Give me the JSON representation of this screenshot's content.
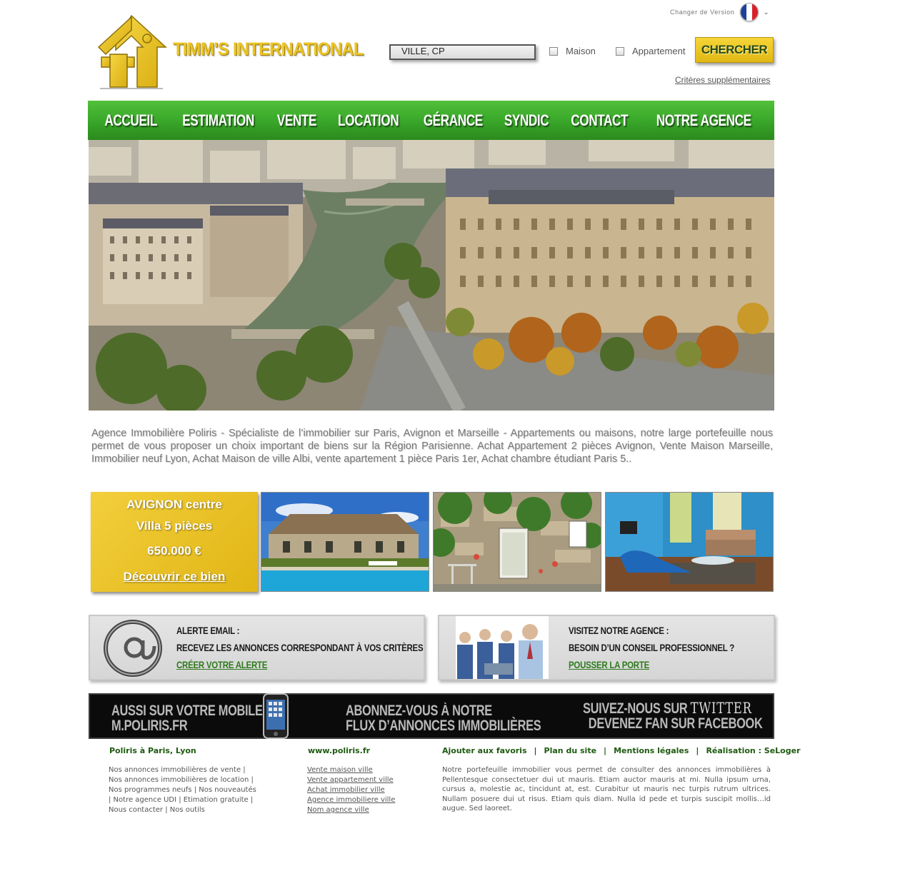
{
  "header": {
    "change_version_label": "Changer de Version",
    "brand_name": "TIMM'S INTERNATIONAL",
    "search": {
      "value": "VILLE, CP",
      "checkbox_maison": "Maison",
      "checkbox_appartement": "Appartement",
      "button": "CHERCHER",
      "extra_criteria": "Critères supplémentaires"
    }
  },
  "nav": {
    "items": [
      "ACCUEIL",
      "ESTIMATION",
      "VENTE",
      "LOCATION",
      "GÉRANCE",
      "SYNDIC",
      "CONTACT",
      "NOTRE AGENCE"
    ]
  },
  "intro_text": "Agence Immobilière Poliris - Spécialiste de l’immobilier sur Paris, Avignon et Marseille - Appartements ou maisons, notre large portefeuille nous permet de vous proposer un choix important de biens sur la Région Parisienne. Achat Appartement 2 pièces Avignon, Vente Maison Marseille, Immobilier neuf Lyon, Achat Maison de ville Albi, vente apartement 1 pièce Paris 1er, Achat chambre étudiant Paris 5..",
  "featured": {
    "city": "AVIGNON centre",
    "type": "Villa 5 pièces",
    "price": "650.000 €",
    "cta": "Découvrir ce bien"
  },
  "promo_alert": {
    "title": "ALERTE EMAIL :",
    "text": "RECEVEZ LES ANNONCES CORRESPONDANT À VOS CRITÈRES",
    "link": "CRÉER VOTRE ALERTE"
  },
  "promo_agency": {
    "title": "VISITEZ NOTRE AGENCE :",
    "text": "BESOIN D’UN CONSEIL PROFESSIONNEL ?",
    "link": "POUSSER LA PORTE"
  },
  "banner": {
    "mobile_line1": "AUSSI SUR VOTRE  MOBILE",
    "mobile_line2": "M.POLIRIS.FR",
    "rss_line1": "ABONNEZ-VOUS À NOTRE",
    "rss_line2": "FLUX D’ANNONCES IMMOBILIÈRES",
    "social_line1_prefix": "SUIVEZ-NOUS SUR ",
    "social_line1_brand": "TWITTER",
    "social_line2": "DEVENEZ FAN SUR FACEBOOK"
  },
  "footer": {
    "col1_title": "Poliris à Paris, Lyon",
    "col1_lines": [
      "Nos annonces immobilières de vente |",
      "Nos annonces immobilières de location |",
      "Nos programmes neufs | Nos nouveautés",
      "| Notre agence UDI | Etimation gratuite |",
      "Nous contacter | Nos outils"
    ],
    "col2_title": "www.poliris.fr",
    "col2_links": [
      "Vente maison ville",
      "Vente appartement ville",
      "Achat immobilier ville",
      "Agence immobiliere ville",
      "Nom agence ville"
    ],
    "links": [
      "Ajouter aux favoris",
      "Plan du site",
      "Mentions légales",
      "Réalisation : SeLoger"
    ],
    "separator": "|",
    "text": "Notre portefeuille immobilier vous permet de consulter des annonces immobilières à Pellentesque consectetuer dui ut mauris. Etiam auctor mauris at mi. Nulla ipsum urna, cursus a, molestie ac, tincidunt at, est. Curabitur ut mauris nec turpis rutrum ultrices. Nullam posuere dui ut risus. Etiam quis diam. Nulla id pede et turpis suscipit mollis…id augue. Sed laoreet."
  },
  "colors": {
    "brand_yellow": "#ecc425",
    "nav_green": "#3aa82a",
    "link_green": "#2f7a1d",
    "banner_black": "#0b0b0b"
  }
}
